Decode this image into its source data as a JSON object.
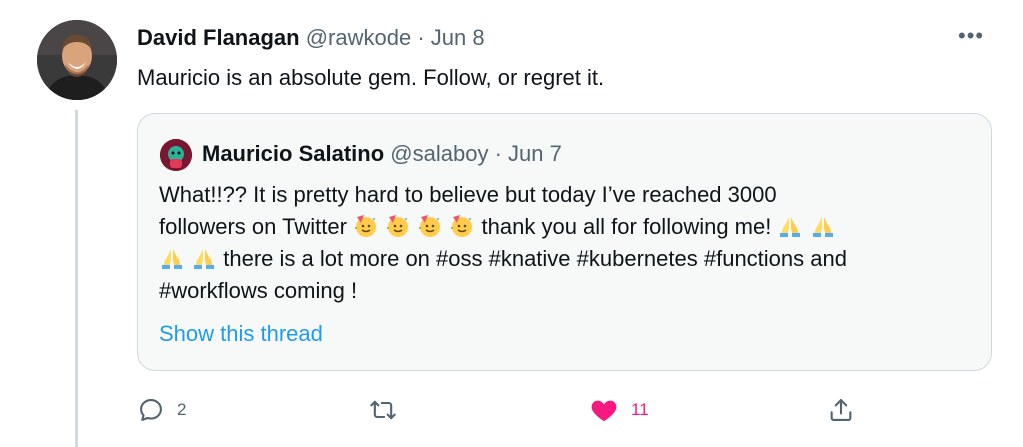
{
  "tweet": {
    "author_name": "David Flanagan",
    "author_handle": "@rawkode",
    "separator": "·",
    "date": "Jun 8",
    "more_label": "•••",
    "text": "Mauricio is an absolute gem. Follow, or regret it."
  },
  "quoted_tweet": {
    "author_name": "Mauricio Salatino",
    "author_handle": "@salaboy",
    "separator": "·",
    "date": "Jun 7",
    "line1": "What!!?? It is pretty hard to believe but today I’ve reached 3000",
    "line2_before": "followers on Twitter",
    "line2_after": "thank you all for following me!",
    "line3_after": "there is a lot more on #oss #knative #kubernetes #functions and",
    "line4": "#workflows coming !",
    "emojis_line2_party": [
      "partying-face",
      "partying-face",
      "partying-face",
      "partying-face"
    ],
    "emojis_line2_pray": [
      "folded-hands",
      "folded-hands"
    ],
    "emojis_line3_pray": [
      "folded-hands",
      "folded-hands"
    ],
    "show_thread": "Show this thread"
  },
  "actions": {
    "reply_icon": "reply-icon",
    "reply_count": "2",
    "retweet_icon": "retweet-icon",
    "like_icon": "heart-icon",
    "like_count": "11",
    "share_icon": "share-icon"
  },
  "colors": {
    "link": "#1d9bf0",
    "like": "#f91880",
    "muted": "#536471",
    "border": "#cfd9de",
    "quote_bg": "#f7f9f9"
  }
}
